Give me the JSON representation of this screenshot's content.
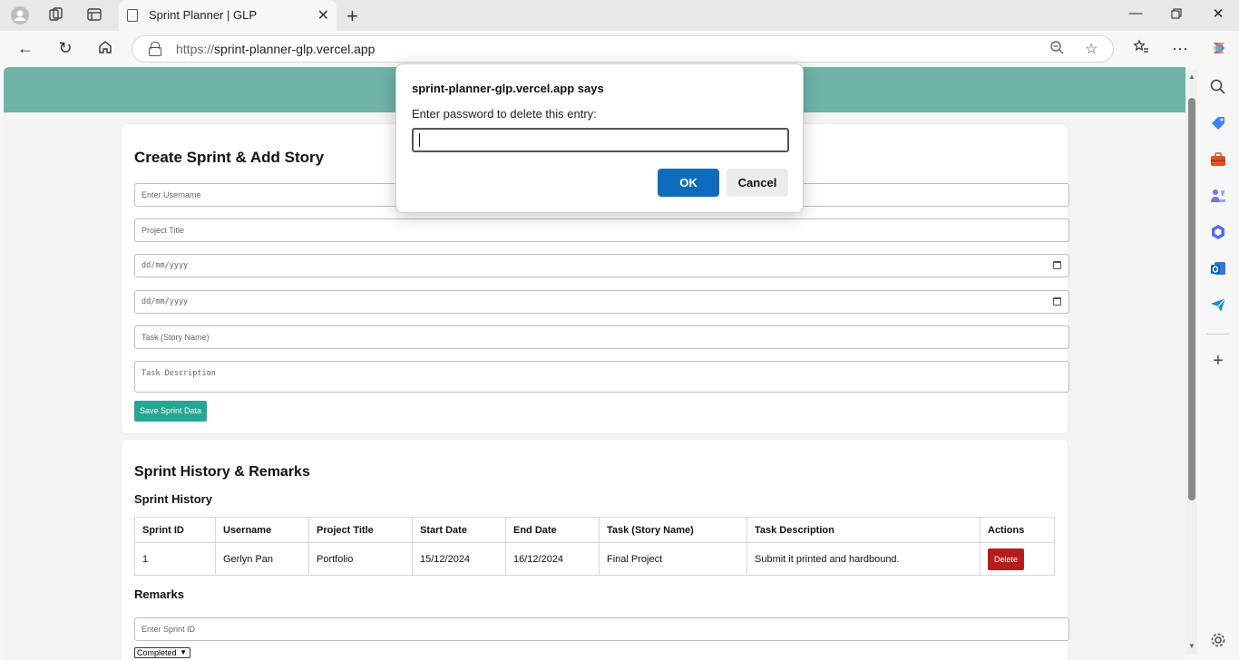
{
  "browser": {
    "tab_title": "Sprint Planner | GLP",
    "url_protocol": "https://",
    "url_host": "sprint-planner-glp.vercel.app"
  },
  "create_form": {
    "heading": "Create Sprint & Add Story",
    "username_placeholder": "Enter Username",
    "project_title_placeholder": "Project Title",
    "start_date_placeholder": "dd/mm/yyyy",
    "end_date_placeholder": "dd/mm/yyyy",
    "task_placeholder": "Task (Story Name)",
    "task_description_placeholder": "Task Description",
    "save_label": "Save Sprint Data"
  },
  "history": {
    "heading": "Sprint History & Remarks",
    "subheading": "Sprint History",
    "columns": [
      "Sprint ID",
      "Username",
      "Project Title",
      "Start Date",
      "End Date",
      "Task (Story Name)",
      "Task Description",
      "Actions"
    ],
    "rows": [
      {
        "sprint_id": "1",
        "username": "Gerlyn Pan",
        "project_title": "Portfolio",
        "start_date": "15/12/2024",
        "end_date": "16/12/2024",
        "task": "Final Project",
        "description": "Submit it printed and hardbound.",
        "action_label": "Delete"
      }
    ]
  },
  "remarks": {
    "heading": "Remarks",
    "sprint_id_placeholder": "Enter Sprint ID",
    "status_selected": "Completed"
  },
  "dialog": {
    "title": "sprint-planner-glp.vercel.app says",
    "message": "Enter password to delete this entry:",
    "ok_label": "OK",
    "cancel_label": "Cancel"
  },
  "colors": {
    "header_band": "#6fb3a8",
    "save_button": "#26a693",
    "delete_button": "#b71c1c",
    "ok_button": "#0f6cbd"
  }
}
